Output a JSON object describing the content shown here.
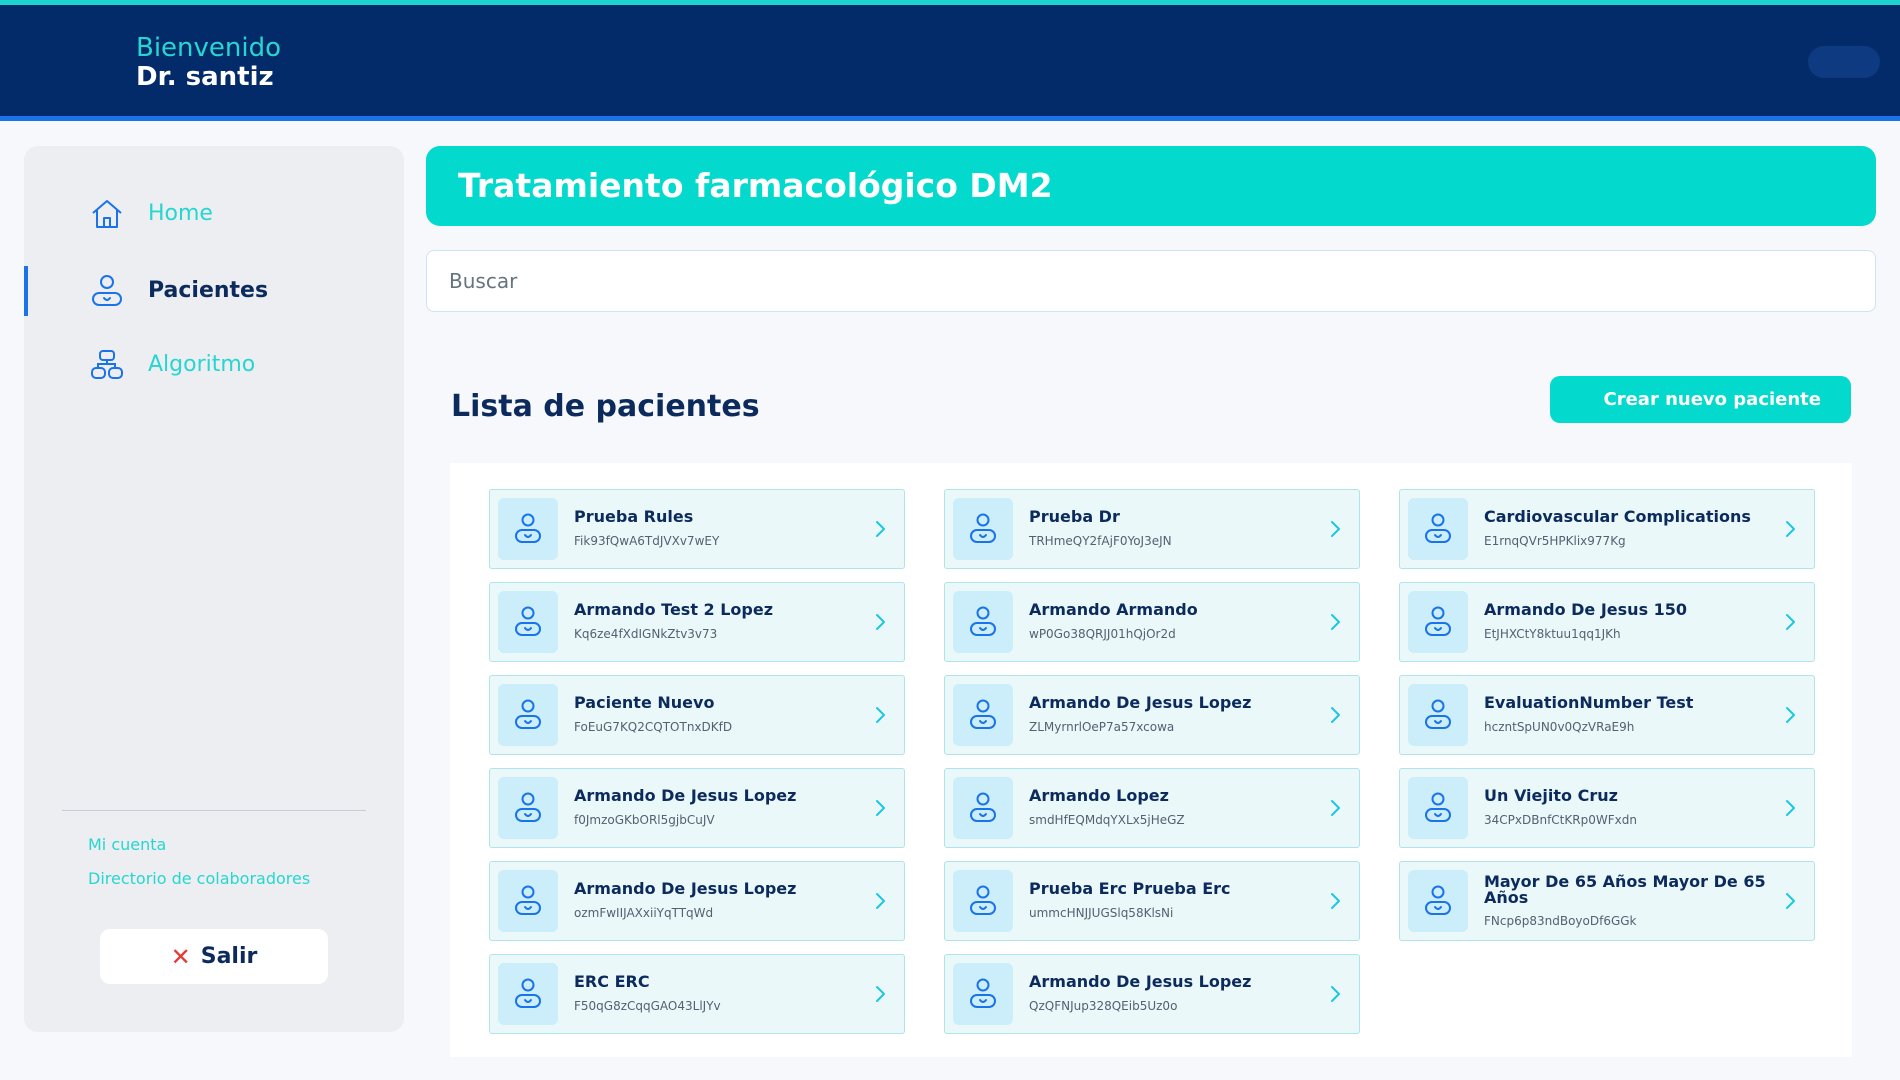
{
  "header": {
    "greeting": "Bienvenido",
    "user_name": "Dr. santiz"
  },
  "sidebar": {
    "items": [
      {
        "label": "Home",
        "icon": "home-icon",
        "active": false
      },
      {
        "label": "Pacientes",
        "icon": "patient-icon",
        "active": true
      },
      {
        "label": "Algoritmo",
        "icon": "algorithm-icon",
        "active": false
      }
    ],
    "links": [
      "Mi cuenta",
      "Directorio de colaboradores"
    ],
    "logout_label": "Salir"
  },
  "main": {
    "title": "Tratamiento farmacológico DM2",
    "search_placeholder": "Buscar",
    "list_title": "Lista de pacientes",
    "create_button_label": "Crear nuevo paciente",
    "patients": [
      {
        "name": "Prueba Rules",
        "id": "Fik93fQwA6TdJVXv7wEY"
      },
      {
        "name": "Prueba Dr",
        "id": "TRHmeQY2fAjF0YoJ3eJN"
      },
      {
        "name": "Cardiovascular Complications",
        "id": "E1rnqQVr5HPKlix977Kg"
      },
      {
        "name": "Armando Test 2 Lopez",
        "id": "Kq6ze4fXdIGNkZtv3v73"
      },
      {
        "name": "Armando Armando",
        "id": "wP0Go38QRJJ01hQjOr2d"
      },
      {
        "name": "Armando De Jesus 150",
        "id": "EtJHXCtY8ktuu1qq1JKh"
      },
      {
        "name": "Paciente Nuevo",
        "id": "FoEuG7KQ2CQTOTnxDKfD"
      },
      {
        "name": "Armando De Jesus Lopez",
        "id": "ZLMyrnrlOeP7a57xcowa"
      },
      {
        "name": "EvaluationNumber Test",
        "id": "hczntSpUN0v0QzVRaE9h"
      },
      {
        "name": "Armando De Jesus Lopez",
        "id": "f0JmzoGKbORl5gjbCuJV"
      },
      {
        "name": "Armando Lopez",
        "id": "smdHfEQMdqYXLx5jHeGZ"
      },
      {
        "name": "Un Viejito Cruz",
        "id": "34CPxDBnfCtKRp0WFxdn"
      },
      {
        "name": "Armando De Jesus Lopez",
        "id": "ozmFwIIJAXxiiYqTTqWd"
      },
      {
        "name": "Prueba Erc Prueba Erc",
        "id": "ummcHNJJUGSlq58KlsNi"
      },
      {
        "name": "Mayor De 65 Años Mayor De 65 Años",
        "id": "FNcp6p83ndBoyoDf6GGk"
      },
      {
        "name": "ERC ERC",
        "id": "F50qG8zCqqGAO43LlJYv"
      },
      {
        "name": "Armando De Jesus Lopez",
        "id": "QzQFNJup328QEib5Uz0o"
      }
    ]
  },
  "colors": {
    "header_bg": "#042b69",
    "accent_teal": "#03d9cc",
    "accent_blue": "#1a73e8",
    "text_dark": "#0c2b5c"
  }
}
